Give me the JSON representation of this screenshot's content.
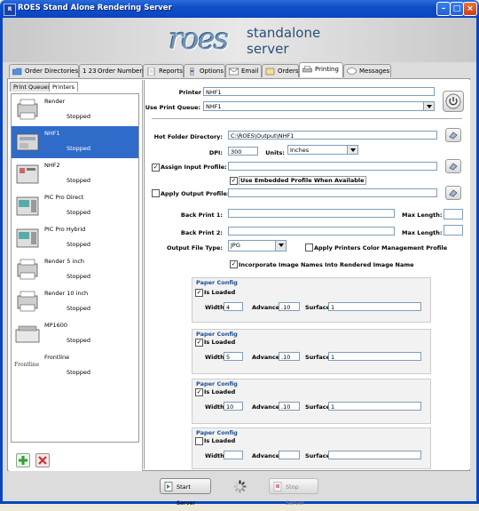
{
  "window": {
    "title": "ROES Stand Alone Rendering Server",
    "icon_text": "R",
    "controls": [
      "minimize-icon",
      "maximize-icon",
      "close-icon"
    ]
  },
  "logo": {
    "mark": "roes",
    "line1": "standalone",
    "line2": "server"
  },
  "tabs": [
    {
      "label": "Order Directories",
      "icon": "folder-icon"
    },
    {
      "label": "Order Numbers",
      "icon": "numbers-icon"
    },
    {
      "label": "Reports",
      "icon": "report-icon"
    },
    {
      "label": "Options",
      "icon": "options-icon"
    },
    {
      "label": "Email",
      "icon": "email-icon"
    },
    {
      "label": "Orders",
      "icon": "orders-icon"
    },
    {
      "label": "Printing",
      "icon": "printer-icon"
    },
    {
      "label": "Messages",
      "icon": "messages-icon"
    }
  ],
  "active_tab": "Printing",
  "subtabs": [
    {
      "label": "Print Queues"
    },
    {
      "label": "Printers"
    }
  ],
  "printers": [
    {
      "name": "Render",
      "status": "Stopped"
    },
    {
      "name": "NHF1",
      "status": "Stopped"
    },
    {
      "name": "NHF2",
      "status": "Stopped"
    },
    {
      "name": "PIC Pro Direct",
      "status": "Stopped"
    },
    {
      "name": "PIC Pro Hybrid",
      "status": "Stopped"
    },
    {
      "name": "Render 5 inch",
      "status": "Stopped"
    },
    {
      "name": "Render 10 inch",
      "status": "Stopped"
    },
    {
      "name": "MP1600",
      "status": "Stopped"
    },
    {
      "name": "Frontline",
      "status": "Stopped",
      "logo_text": "Frontline"
    }
  ],
  "selected_printer": "NHF1",
  "form": {
    "printer_name_label": "Printer Name:",
    "printer_name": "NHF1",
    "use_print_queue_label": "Use Print Queue:",
    "use_print_queue": "NHF1",
    "hot_folder_label": "Hot Folder Directory:",
    "hot_folder": "C:\\ROES\\Output\\NHF1",
    "dpi_label": "DPI:",
    "dpi": "300",
    "units_label": "Units:",
    "units": "Inches",
    "assign_input_profile_label": "Assign Input Profile:",
    "assign_input_profile_checked": true,
    "input_profile": "",
    "use_embedded_label": "Use Embedded Profile When Available",
    "use_embedded_checked": true,
    "apply_output_profile_label": "Apply Output Profile:",
    "apply_output_profile_checked": false,
    "output_profile": "",
    "back_print1_label": "Back Print 1:",
    "back_print1": "",
    "back_print2_label": "Back Print 2:",
    "back_print2": "",
    "max_length_label": "Max Length:",
    "max_length1": "",
    "max_length2": "",
    "output_file_type_label": "Output File Type:",
    "output_file_type": "JPG",
    "apply_cm_profile_label": "Apply Printers Color Management  Profile",
    "apply_cm_profile_checked": false,
    "incorporate_names_label": "Incorporate Image Names Into Rendered Image Name",
    "incorporate_names_checked": true
  },
  "paper_configs": [
    {
      "title": "Paper Config",
      "is_loaded_label": "Is Loaded",
      "is_loaded": true,
      "width_label": "Width:",
      "width": "4",
      "advance_label": "Advance:",
      "advance": ".10",
      "surface_label": "Surface:",
      "surface": "1"
    },
    {
      "title": "Paper Config",
      "is_loaded_label": "Is Loaded",
      "is_loaded": true,
      "width_label": "Width:",
      "width": "5",
      "advance_label": "Advance:",
      "advance": ".10",
      "surface_label": "Surface:",
      "surface": "1"
    },
    {
      "title": "Paper Config",
      "is_loaded_label": "Is Loaded",
      "is_loaded": true,
      "width_label": "Width:",
      "width": "10",
      "advance_label": "Advance:",
      "advance": ".10",
      "surface_label": "Surface:",
      "surface": "1"
    },
    {
      "title": "Paper Config",
      "is_loaded_label": "Is Loaded",
      "is_loaded": false,
      "width_label": "Width:",
      "width": "",
      "advance_label": "Advance:",
      "advance": "",
      "surface_label": "Surface:",
      "surface": ""
    }
  ],
  "footer": {
    "start_label": "Start Server",
    "stop_label": "Stop Server",
    "stop_disabled": true
  },
  "colors": {
    "titlebar": "#0f4fc8",
    "selection": "#2f6bc8",
    "paper_config_title": "#1f4f8f"
  }
}
